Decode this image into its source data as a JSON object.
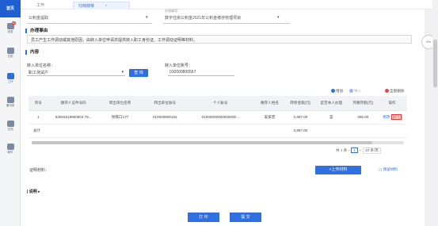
{
  "app": {
    "logo": "首页"
  },
  "sidebar": {
    "items": [
      {
        "label": "消息",
        "badge": "99"
      },
      {
        "label": "日历"
      },
      {
        "label": "工作"
      },
      {
        "label": "通讯录"
      },
      {
        "label": "文档"
      },
      {
        "label": "邮件"
      }
    ]
  },
  "tabs": [
    {
      "label": "工作"
    },
    {
      "label": "归档转移"
    }
  ],
  "header_selects": {
    "left_value": "公积金提取",
    "right_label": "办理事项：",
    "right_value": "数字住房公积金2021年公积金缴存管理项目"
  },
  "zoom": "0%",
  "reason": {
    "title": "办理事由",
    "text": "员工产生工作调动或其他原因，由转入单位申请并提供转入职工身份证、工作调动证明等材料。"
  },
  "content": {
    "title": "内容",
    "transfer_unit_label": "转入单位名称：",
    "transfer_unit_value": "职工测试户",
    "query_button": "查 询",
    "account_label": "转入单位账号：",
    "account_value": "010000800567"
  },
  "toolbar": {
    "add": "增加",
    "import": "导入",
    "delete_all": "全部删除"
  },
  "table": {
    "headers": [
      "序号",
      "缴存人证件号码",
      "转出单位名称",
      "转出单位账号",
      "个人账号",
      "缴存人姓名",
      "转移金额(元)",
      "是否本人办理",
      "月缴存额(元)",
      "操作"
    ],
    "rows": [
      [
        "1",
        "53062519950604 76...",
        "地铁口177",
        "010000800162",
        "01000000000000000...",
        "安爱宏",
        "2,897.00",
        "是",
        "266.00",
        "修改",
        "删除"
      ]
    ],
    "total": [
      "总计",
      "2,897.00"
    ]
  },
  "pager": {
    "total": "共 1 条",
    "page": "1",
    "page_size": "10 条/页"
  },
  "attachments": {
    "label": "证明材料：",
    "upload_button": "+上传材料",
    "preview_button": "预览材料"
  },
  "notes": {
    "label": "| 说明 ▸"
  },
  "footer": {
    "print": "打 印",
    "submit": "提 交"
  }
}
